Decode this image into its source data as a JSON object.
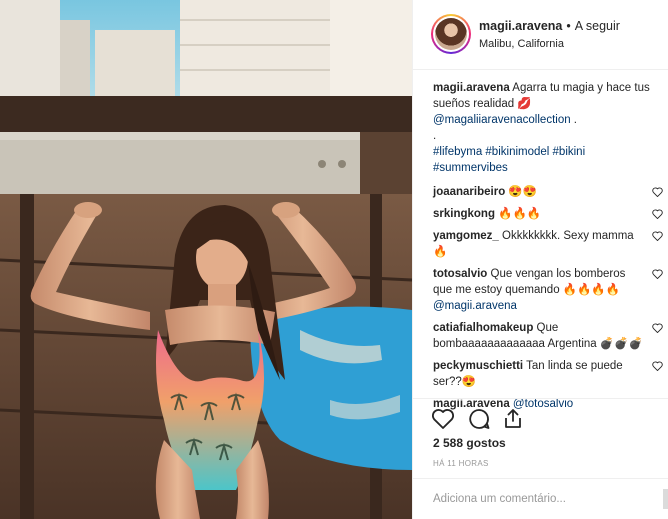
{
  "post": {
    "username": "magii.aravena",
    "dot": "•",
    "follow_label": "A seguir",
    "location": "Malibu, California",
    "caption": {
      "username": "magii.aravena",
      "text": "Agarra tu magia y hace tus sueños realidad 💋",
      "mention": "@magaliiaravenacollection",
      "after_mention": " .",
      "period": ".",
      "hashtags_line1": "#lifebyma #bikinimodel #bikini",
      "hashtags_line2": "#summervibes"
    },
    "comments": [
      {
        "username": "joaanaribeiro",
        "text": "😍😍"
      },
      {
        "username": "srkingkong",
        "text": "🔥🔥🔥"
      },
      {
        "username": "yamgomez_",
        "text": "Okkkkkkkk. Sexy mamma 🔥"
      },
      {
        "username": "totosalvio",
        "text": "Que vengan los bomberos que me estoy quemando 🔥🔥🔥🔥",
        "mention": "@magii.aravena"
      },
      {
        "username": "catiafialhomakeup",
        "text": "Que bombaaaaaaaaaaaaa Argentina 💣💣💣"
      },
      {
        "username": "peckymuschietti",
        "text": "Tan linda se puede ser??😍"
      },
      {
        "username": "magii.aravena",
        "mention": "@totosalvio"
      }
    ],
    "likes": "2 588 gostos",
    "time": "HÁ 11 HORAS",
    "add_comment_placeholder": "Adiciona um comentário..."
  },
  "icons": {
    "like": "heart-icon",
    "comment": "comment-icon",
    "share": "share-icon",
    "comment_like": "heart-outline-icon"
  },
  "colors": {
    "link": "#003569",
    "text": "#262626",
    "muted": "#999999",
    "border": "#efefef"
  }
}
